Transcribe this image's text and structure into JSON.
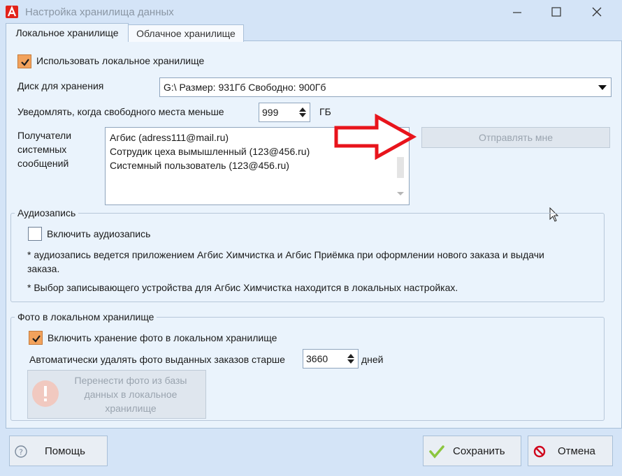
{
  "window": {
    "title": "Настройка хранилища данных"
  },
  "tabs": [
    {
      "label": "Локальное хранилище",
      "active": true
    },
    {
      "label": "Облачное хранилище",
      "active": false
    }
  ],
  "local": {
    "use_local_label": "Использовать локальное хранилище",
    "use_local_checked": true,
    "disk_label": "Диск для хранения",
    "disk_value": "G:\\ Размер: 931Гб Свободно: 900Гб",
    "notify_label": "Уведомлять, когда свободного места меньше",
    "notify_value": "999",
    "notify_unit": "ГБ",
    "recipients_label_1": "Получатели",
    "recipients_label_2": "системных",
    "recipients_label_3": "сообщений",
    "recipients": [
      "Агбис (adress111@mail.ru)",
      "Сотрудик цеха вымышленный (123@456.ru)",
      "Системный пользователь (123@456.ru)"
    ],
    "send_me_label": "Отправлять мне"
  },
  "audio": {
    "group_title": "Аудиозапись",
    "enable_label": "Включить аудиозапись",
    "enable_checked": false,
    "note1_line1": "* аудиозапись ведется приложением Агбис Химчистка и Агбис Приёмка при оформлении нового заказа и выдачи",
    "note1_line2": "заказа.",
    "note2": "* Выбор записывающего устройства для Агбис Химчистка находится в локальных настройках."
  },
  "photo": {
    "group_title": "Фото в локальном хранилище",
    "enable_label": "Включить хранение фото в локальном хранилище",
    "enable_checked": true,
    "auto_delete_label": "Автоматически удалять фото выданных заказов старше",
    "auto_delete_value": "3660",
    "auto_delete_unit": "дней",
    "transfer_line1": "Перенести фото из базы",
    "transfer_line2": "данных в локальное",
    "transfer_line3": "хранилище"
  },
  "footer": {
    "help_label": "Помощь",
    "save_label": "Сохранить",
    "cancel_label": "Отмена"
  },
  "colors": {
    "accent_check": "#f2a25c",
    "annotation_arrow": "#e8141c",
    "save_check": "#8cc63f",
    "cancel_icon": "#d0021b"
  }
}
